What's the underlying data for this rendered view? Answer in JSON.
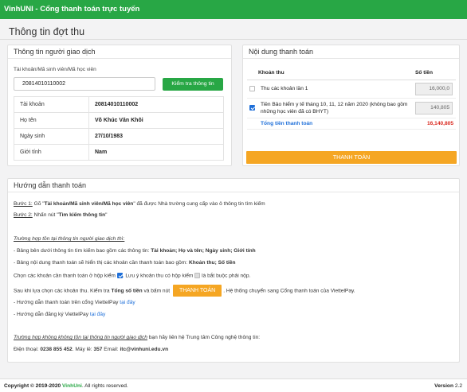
{
  "app": {
    "title": "VinhUNI - Cổng thanh toán trực tuyến"
  },
  "page": {
    "title": "Thông tin đợt thu"
  },
  "left_panel": {
    "title": "Thông tin người giao dịch",
    "input_label": "Tài khoản/Mã sinh viên/Mã học viên",
    "input_value": "20814010110002",
    "check_button": "Kiểm tra thông tin",
    "rows": [
      {
        "key": "Tài khoản",
        "value": "20814010110002"
      },
      {
        "key": "Họ tên",
        "value": "Võ Khúc Văn Khôi"
      },
      {
        "key": "Ngày sinh",
        "value": "27/10/1983"
      },
      {
        "key": "Giới tính",
        "value": "Nam"
      }
    ]
  },
  "right_panel": {
    "title": "Nội dung thanh toán",
    "col_item": "Khoản thu",
    "col_amount": "Số tiền",
    "items": [
      {
        "label": "Thu các khoản lần 1",
        "amount": "16,000,0",
        "checked": false
      },
      {
        "label": "Tiền Bảo hiểm y tế tháng 10, 11, 12 năm 2020 (không bao gồm những học viên đã có BHYT)",
        "amount": "140,805",
        "checked": true
      }
    ],
    "total_label": "Tổng tiền thanh toán",
    "total_value": "16,140,805",
    "pay_button": "THANH TOÁN"
  },
  "guide": {
    "title": "Hướng dẫn thanh toán",
    "step1_prefix": "Bước 1:",
    "step1_a": " Gõ \"",
    "step1_bold": "Tài khoản/Mã sinh viên/Mã học viên",
    "step1_b": "\" đã được Nhà trường cung cấp vào ô thông tin tìm kiếm",
    "step2_prefix": "Bước 2:",
    "step2_a": " Nhấn nút \"",
    "step2_bold": "Tìm kiếm thông tin",
    "step2_b": "\"",
    "case1": "Trường hợp tồn tại thông tin người giao dịch thì:",
    "line1_a": "- Bảng bên dưới thông tin tìm kiếm bao gồm các thông tin: ",
    "line1_bold": "Tài khoản; Họ và tên; Ngày sinh; Giới tính",
    "line2_a": "- Bảng nội dung thanh toán sẽ hiển thị các khoản cần thanh toán bao gồm: ",
    "line2_bold": "Khoản thu; Số tiền",
    "line3_a": "Chọn các khoản cần thanh toán ở hộp kiểm",
    "line3_b": ". Lưu ý khoản thu có hộp kiểm",
    "line3_c": " là bắt buộc phải nộp.",
    "line4_a": "Sau khi lựa chọn các khoản thu. Kiểm tra ",
    "line4_bold": "Tổng số tiền",
    "line4_b": " và bấm nút",
    "line4_button": "THANH TOÁN",
    "line4_c": ". Hệ thống chuyển sang Cổng thanh toán của ViettelPay.",
    "line5_a": "- Hướng dẫn thanh toán trên cổng ViettelPay ",
    "line5_link": "tại đây",
    "line6_a": "- Hướng dẫn đăng ký ViettelPay ",
    "line6_link": "tại đây",
    "case2": "Trường hợp không không tồn tại thông tin người giao dịch",
    "case2_b": " bạn hãy liên hệ Trung tâm Công nghệ thông tin:",
    "contact_a": "Điện thoại: ",
    "phone": "0238 855 452",
    "contact_b": ". Máy lẻ: ",
    "ext": "357",
    "contact_c": " Email: ",
    "email": "itc@vinhuni.edu.vn"
  },
  "footer": {
    "copyright_a": "Copyright © 2019-2020 ",
    "brand": "VinhUni",
    "copyright_b": ". All rights reserved.",
    "version_label": "Version",
    "version": "2.2"
  }
}
